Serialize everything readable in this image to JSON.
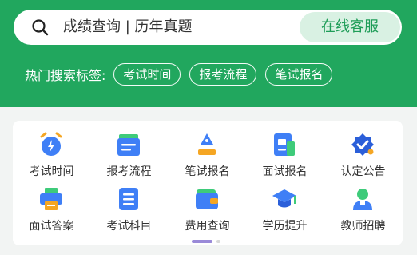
{
  "search": {
    "placeholder": "成绩查询 | 历年真题",
    "service_label": "在线客服"
  },
  "hot_tags": {
    "label": "热门搜索标签:",
    "tags": [
      "考试时间",
      "报考流程",
      "笔试报名"
    ]
  },
  "menu": {
    "items": [
      {
        "label": "考试时间",
        "icon": "alarm-clock-icon"
      },
      {
        "label": "报考流程",
        "icon": "folder-flow-icon"
      },
      {
        "label": "笔试报名",
        "icon": "pen-nib-icon"
      },
      {
        "label": "面试报名",
        "icon": "document-form-icon"
      },
      {
        "label": "认定公告",
        "icon": "verified-badge-icon"
      },
      {
        "label": "面试答案",
        "icon": "printer-icon"
      },
      {
        "label": "考试科目",
        "icon": "list-book-icon"
      },
      {
        "label": "费用查询",
        "icon": "wallet-icon"
      },
      {
        "label": "学历提升",
        "icon": "graduation-cap-icon"
      },
      {
        "label": "教师招聘",
        "icon": "teacher-person-icon"
      }
    ],
    "page_index": 1,
    "page_count": 2
  },
  "colors": {
    "brand_green": "#21a75e",
    "icon_blue": "#3f7ff6",
    "icon_dark_blue": "#2b5fd9",
    "icon_orange": "#f5a623",
    "icon_green": "#3ecb7a",
    "pager_active": "#9a8ad8"
  }
}
